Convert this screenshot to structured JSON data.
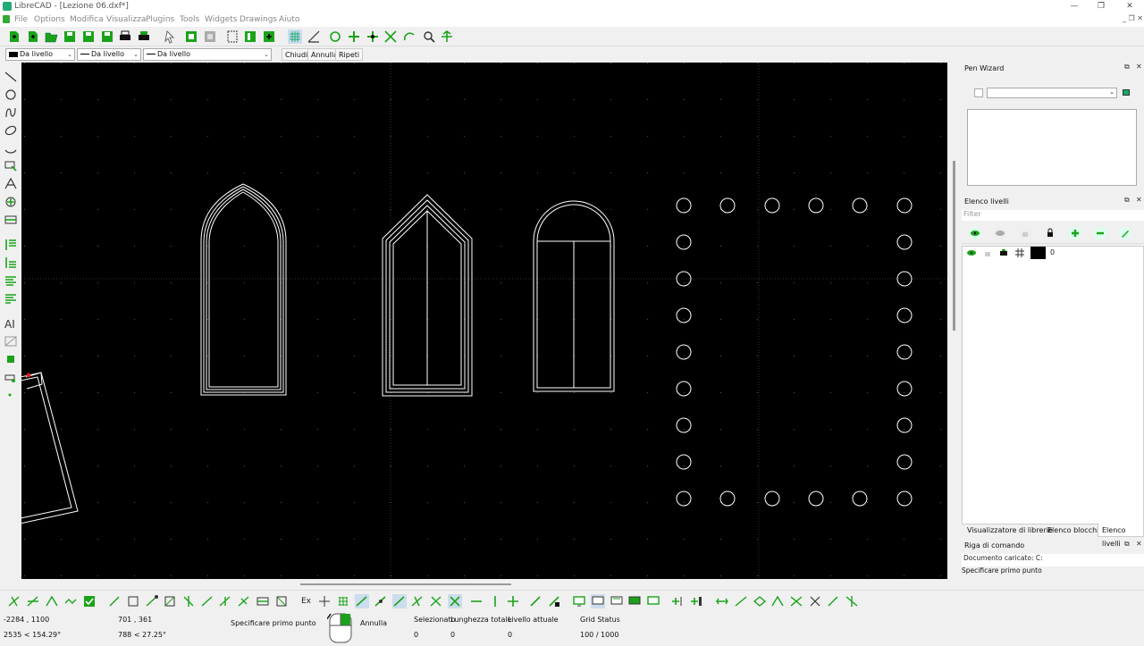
{
  "window": {
    "title": "LibreCAD - [Lezione 06.dxf*]",
    "controls": [
      "minimize-icon",
      "restore-icon",
      "close-icon"
    ]
  },
  "menu": [
    "File",
    "Options",
    "Modifica",
    "Visualizza",
    "Plugins",
    "Tools",
    "Widgets",
    "Drawings",
    "Aiuto"
  ],
  "propbar": {
    "color": "Da livello",
    "linetype": "Da livello",
    "linewidth": "Da livello",
    "close": "Chiudi",
    "undo": "Annulla",
    "redo": "Ripeti"
  },
  "pen_wizard": {
    "title": "Pen Wizard"
  },
  "layers": {
    "title": "Elenco livelli",
    "filter_placeholder": "Filter",
    "rows": [
      {
        "name": "0",
        "color": "#000000",
        "visible": true,
        "locked": false,
        "printable": true
      }
    ]
  },
  "tabs": [
    "Visualizzatore di librerie",
    "Elenco blocchi",
    "Elenco livelli"
  ],
  "active_tab": "Elenco livelli",
  "command": {
    "title": "Riga di comando",
    "output": "Documento caricato: C:",
    "prompt": "Specificare primo punto"
  },
  "status": {
    "abs_coord": "-2284 , 1100",
    "abs_polar": "2535 < 154.29°",
    "rel_coord": "701 , 361",
    "rel_polar": "788 < 27.25°",
    "hint": "Specificare primo punto",
    "mouse_right": "Annulla",
    "selected_label": "Selezionato",
    "selected_value": "0",
    "length_label": "Lunghezza totale",
    "length_value": "0",
    "layer_label": "Livello attuale",
    "layer_value": "0",
    "grid_label": "Grid Status",
    "grid_value": "100 / 1000"
  },
  "snapbar": {
    "ex_label": "Ex"
  },
  "colors": {
    "canvas": "#000000",
    "drawing": "#ffffff",
    "accent_green": "#1aa31a",
    "toolbar_bg": "#f0f0f0"
  }
}
